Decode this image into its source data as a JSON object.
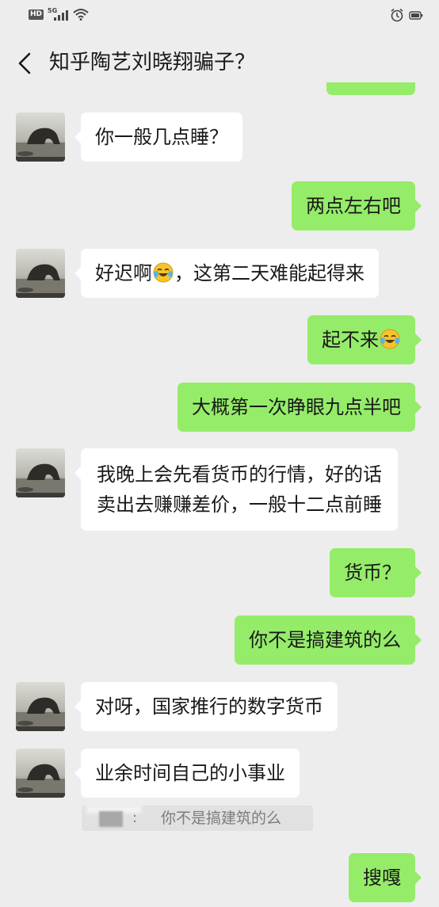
{
  "status_bar": {
    "hd_label": "HD",
    "network_label": "5G"
  },
  "header": {
    "title": "知乎陶艺刘晓翔骗子？"
  },
  "messages": [
    {
      "side": "left",
      "text": "你一般几点睡？"
    },
    {
      "side": "right",
      "text": "两点左右吧"
    },
    {
      "side": "left",
      "text_before": "好迟啊",
      "emoji": "laughing-tears",
      "text_after": "，这第二天难能起得来"
    },
    {
      "side": "right",
      "text_before": "起不来",
      "emoji": "laughing-tears",
      "text_after": ""
    },
    {
      "side": "right",
      "text": "大概第一次睁眼九点半吧"
    },
    {
      "side": "left",
      "lines": [
        "我晚上会先看货币的行情，好的话",
        "卖出去赚赚差价，一般十二点前睡"
      ]
    },
    {
      "side": "right",
      "text": "货币？"
    },
    {
      "side": "right",
      "text": "你不是搞建筑的么"
    },
    {
      "side": "left",
      "text": "对呀，国家推行的数字货币"
    },
    {
      "side": "left",
      "text": "业余时间自己的小事业"
    },
    {
      "side": "right",
      "text": "搜嘎"
    }
  ],
  "quote": {
    "text": "你不是搞建筑的么",
    "separator": ":"
  },
  "colors": {
    "background": "#ededed",
    "bubble_sent": "#95ec69",
    "bubble_received": "#ffffff",
    "text": "#191919",
    "quote_text": "#7c7c7c"
  }
}
